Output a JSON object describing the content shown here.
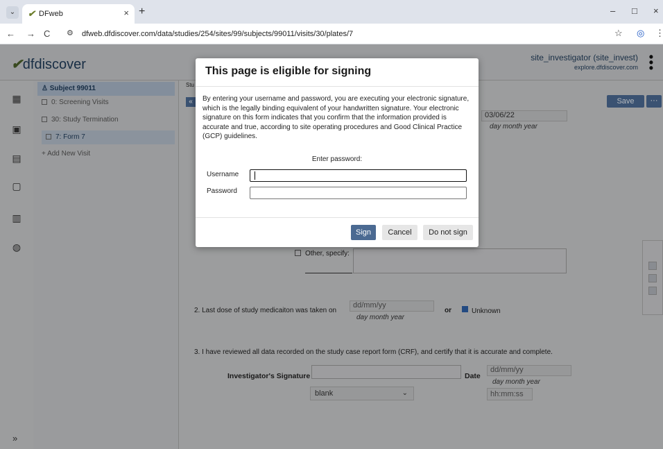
{
  "browser": {
    "tab_title": "DFweb",
    "tab_close": "×",
    "new_tab": "+",
    "url": "dfweb.dfdiscover.com/data/studies/254/sites/99/subjects/99011/visits/30/plates/7",
    "minimize": "–",
    "maximize": "□",
    "close": "×",
    "back": "←",
    "forward": "→",
    "reload": "C",
    "bookmark": "☆",
    "profile": "◎",
    "menu": "⋮"
  },
  "app": {
    "logo_mark": "✔",
    "logo_text": "dfdiscover",
    "user_name": "site_investigator (site_invest)",
    "user_host": "explore.dfdiscover.com"
  },
  "tree": {
    "subject": "Subject 99011",
    "items": [
      "0: Screening Visits",
      "30: Study Termination",
      "7: Form 7",
      "+ Add New Visit"
    ]
  },
  "form": {
    "save_label": "Save",
    "more_label": "···",
    "collapse_label": "«",
    "crumb_stub": "Stu",
    "top_date": "03/06/22",
    "date_sub": "day       month       year",
    "other_label": "Other, specify:",
    "q2_text": "2.   Last dose of study medicaiton was taken on",
    "q2_date_placeholder": "dd/mm/yy",
    "q2_or": "or",
    "q2_unknown": "Unknown",
    "q3_text": "3.   I have reviewed all data recorded on the study case report form (CRF), and certify that it is accurate and complete.",
    "sig_label": "Investigator's Signature",
    "date_label": "Date",
    "sig_date_placeholder": "dd/mm/yy",
    "select_value": "blank",
    "time_placeholder": "hh:mm:ss"
  },
  "modal": {
    "title": "This page is eligible for signing",
    "body": "By entering your username and password, you are executing your electronic signature, which is the legally binding equivalent of your handwritten signature. Your electronic signature on this form indicates that you confirm that the information provided is accurate and true, according to site operating procedures and Good Clinical Practice (GCP) guidelines.",
    "enter_password": "Enter password:",
    "username_label": "Username",
    "password_label": "Password",
    "username_value": "",
    "password_value": "",
    "sign": "Sign",
    "cancel": "Cancel",
    "do_not_sign": "Do not sign"
  },
  "colors": {
    "accent": "#4b6a92",
    "checked": "#2e5fa6"
  }
}
